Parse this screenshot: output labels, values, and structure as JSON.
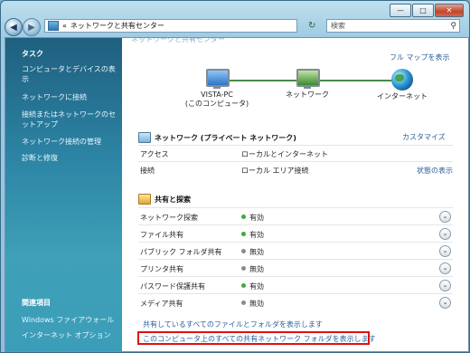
{
  "window": {
    "caption_min": "—",
    "caption_max": "□",
    "caption_close": "✕"
  },
  "address": {
    "chevrons": "«",
    "path": "ネットワークと共有センター",
    "search_placeholder": "検索"
  },
  "sidebar": {
    "tasks_heading": "タスク",
    "tasks": [
      "コンピュータとデバイスの表示",
      "ネットワークに接続",
      "接続またはネットワークのセットアップ",
      "ネットワーク接続の管理",
      "診断と修復"
    ],
    "related_heading": "関連項目",
    "related": [
      "Windows ファイアウォール",
      "インターネット オプション"
    ]
  },
  "map": {
    "cut_title": "ネットワークと共有センター",
    "full_map": "フル マップを表示",
    "pc_name": "VISTA-PC",
    "pc_sub": "(このコンピュータ)",
    "network": "ネットワーク",
    "internet": "インターネット"
  },
  "network": {
    "title": "ネットワーク (プライベート ネットワーク)",
    "customize": "カスタマイズ",
    "rows": [
      {
        "key": "アクセス",
        "value": "ローカルとインターネット",
        "extra": ""
      },
      {
        "key": "接続",
        "value": "ローカル エリア接続",
        "extra": "状態の表示"
      }
    ]
  },
  "sharing": {
    "title": "共有と探索",
    "rows": [
      {
        "key": "ネットワーク探索",
        "value": "有効",
        "status": "on"
      },
      {
        "key": "ファイル共有",
        "value": "有効",
        "status": "on"
      },
      {
        "key": "パブリック フォルダ共有",
        "value": "無効",
        "status": "off"
      },
      {
        "key": "プリンタ共有",
        "value": "無効",
        "status": "off"
      },
      {
        "key": "パスワード保護共有",
        "value": "有効",
        "status": "on"
      },
      {
        "key": "メディア共有",
        "value": "無効",
        "status": "off"
      }
    ]
  },
  "bottom_links": [
    "共有しているすべてのファイルとフォルダを表示します",
    "このコンピュータ上のすべての共有ネットワーク フォルダを表示します"
  ],
  "colors": {
    "on": "#3cab3c",
    "off": "#8a8a8a",
    "highlight_box": "#e01010"
  }
}
